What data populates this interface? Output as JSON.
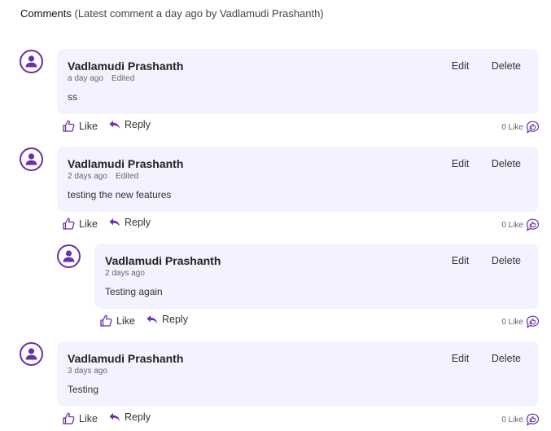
{
  "header": {
    "title": "Comments",
    "subtitle": "(Latest comment a day ago by Vadlamudi Prashanth)"
  },
  "labels": {
    "edit": "Edit",
    "delete": "Delete",
    "like": "Like",
    "reply": "Reply",
    "like_count": "0 Like",
    "edited": "Edited"
  },
  "comments": [
    {
      "author": "Vadlamudi Prashanth",
      "time": "a day ago",
      "edited": true,
      "text": "ss"
    },
    {
      "author": "Vadlamudi Prashanth",
      "time": "2 days ago",
      "edited": true,
      "text": "testing the new features",
      "replies": [
        {
          "author": "Vadlamudi Prashanth",
          "time": "2 days ago",
          "edited": false,
          "text": "Testing again"
        }
      ]
    },
    {
      "author": "Vadlamudi Prashanth",
      "time": "3 days ago",
      "edited": false,
      "text": "Testing"
    }
  ],
  "icons": {
    "avatar": "user-avatar-icon",
    "like": "thumbs-up-icon",
    "reply": "reply-arrow-icon",
    "like_count": "like-chat-bubble-icon"
  },
  "colors": {
    "accent": "#6b2fa8",
    "card_bg": "#f3f2ff"
  }
}
